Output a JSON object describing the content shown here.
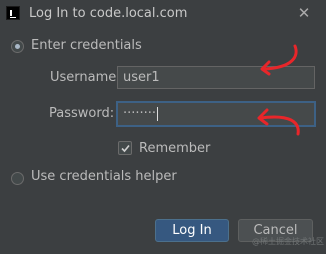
{
  "window": {
    "title": "Log In to code.local.com",
    "app_icon": "intellij-icon",
    "close_icon": "close-icon"
  },
  "auth_options": {
    "enter_credentials_label": "Enter credentials",
    "enter_credentials_selected": true,
    "credentials_helper_label": "Use credentials helper",
    "credentials_helper_selected": false
  },
  "form": {
    "username_label": "Username:",
    "username_value": "user1",
    "password_label": "Password:",
    "password_value": "········",
    "remember_label": "Remember",
    "remember_checked": true
  },
  "buttons": {
    "login_label": "Log In",
    "cancel_label": "Cancel"
  },
  "annotations": {
    "color": "#e8262a"
  },
  "watermark": "@稀土掘金技术社区",
  "colors": {
    "background": "#3c3f41",
    "primary_button": "#365880",
    "focus_border": "#3d6185",
    "text": "#bbbbbb"
  }
}
